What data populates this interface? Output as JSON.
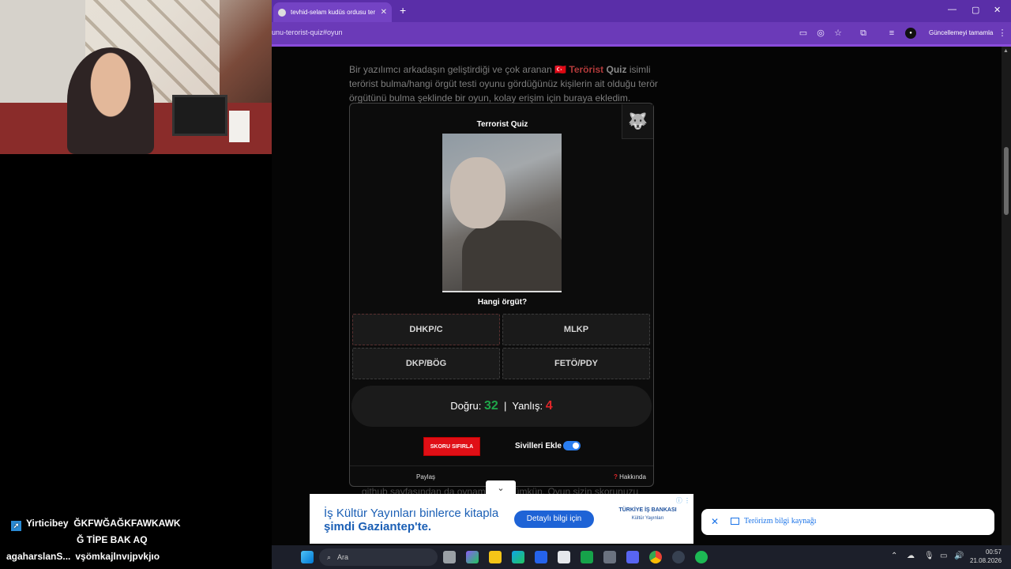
{
  "browser": {
    "tab_title": "tevhid-selam kudüs ordusu ter",
    "new_tab": "+",
    "url": "unu-terorist-quiz#oyun",
    "update_button": "Güncellemeyi tamamla",
    "window_controls": [
      "—",
      "▢",
      "✕"
    ]
  },
  "page": {
    "intro_before": "Bir yazılımcı arkadaşın geliştirdiği ve çok aranan ",
    "intro_flag": "🇹🇷 Terörist",
    "intro_quiz": " Quiz",
    "intro_after": " isimli terörist bulma/hangi örgüt testi oyunu gördüğünüz kişilerin ait olduğu terör örgütünü bulma şeklinde bir oyun, kolay erişim için buraya ekledim.",
    "below_text": "github sayfasından da oynamanız mümkün. Oyun sizin skorunuzu"
  },
  "quiz": {
    "title": "Terrorist Quiz",
    "question": "Hangi örgüt?",
    "options": [
      "DHKP/C",
      "MLKP",
      "DKP/BÖG",
      "FETÖ/PDY"
    ],
    "correct_label": "Doğru:",
    "correct_count": "32",
    "separator": "|",
    "wrong_label": "Yanlış:",
    "wrong_count": "4",
    "reset_button": "SKORU SIFIRLA",
    "toggle_label": "Sivilleri Ekle",
    "toggle_on": true,
    "share": "Paylaş",
    "about": "Hakkında",
    "about_mark": "?"
  },
  "ad": {
    "line1": "İş Kültür Yayınları binlerce kitapla",
    "line2": "şimdi Gaziantep'te.",
    "button": "Detaylı bilgi için",
    "brand": "TÜRKİYE İŞ BANKASI",
    "brand_sub": "Kültür Yayınları"
  },
  "notification": {
    "text": "Terörizm bilgi kaynağı"
  },
  "chat": {
    "user1": "Yirticibey",
    "msg1_line1": "ĞKFWĞAĞKFAWKAWK",
    "msg1_line2": "Ğ TİPE BAK AQ",
    "user2": "agaharslanS...",
    "msg2": "vşömkajlnvıjpvkjıo"
  },
  "taskbar": {
    "search_label": "Ara",
    "time": "00:57",
    "date": "21.08.2026"
  },
  "colors": {
    "tabbar": "#5a2ea8",
    "correct": "#1fa64a",
    "wrong": "#e0262a",
    "reset": "#e00f16",
    "toggle": "#2a7ef0"
  }
}
